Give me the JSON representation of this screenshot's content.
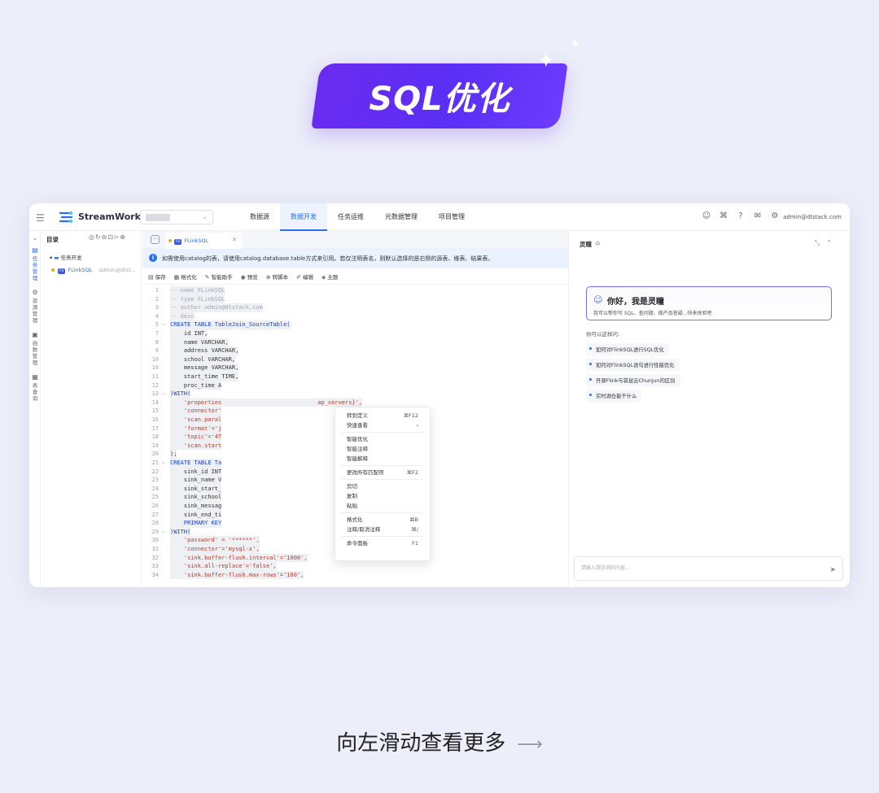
{
  "hero": {
    "title": "SQL优化"
  },
  "footer": {
    "hint": "向左滑动查看更多",
    "arrow": "⟶"
  },
  "app": {
    "logo": "StreamWorks",
    "nav": [
      "数据源",
      "数据开发",
      "任务运维",
      "元数据管理",
      "项目管理"
    ],
    "nav_active_index": 1,
    "user_email": "admin@dtstack.com",
    "rail": [
      {
        "label": "任\n务\n管\n理",
        "icon": "▤",
        "active": true
      },
      {
        "label": "资\n源\n管\n理",
        "icon": "⚙",
        "active": false
      },
      {
        "label": "函\n数\n管\n理",
        "icon": "▣",
        "active": false
      },
      {
        "label": "表\n查\n询",
        "icon": "▦",
        "active": false
      }
    ],
    "directory": {
      "title": "目录",
      "folder": "任务开发",
      "file_badge": "FS",
      "file": "FLinkSQL",
      "file_owner": "admin@dtst..."
    },
    "editor": {
      "tab_badge": "FS",
      "tab_label": "FLinkSQL",
      "notice": "如需使用catalog的表，请使用catalog.database.table方式来引用。若仅注明表名，则默认选择的是右侧的源表、维表、结果表。",
      "toolbar": [
        "保存",
        "格式化",
        "智能助手",
        "预览",
        "转脚本",
        "编辑",
        "主题"
      ],
      "lines": [
        {
          "n": "1",
          "t": "-- name FLinkSQL",
          "k": "com"
        },
        {
          "n": "2",
          "t": "-- type FLinkSQL",
          "k": "com"
        },
        {
          "n": "3",
          "t": "-- author admin@dtstack.com",
          "k": "com"
        },
        {
          "n": "4",
          "t": "-- desc",
          "k": "com"
        },
        {
          "n": "5",
          "t": "CREATE TABLE TableJoin_SourceTable(",
          "k": "kw",
          "fold": true
        },
        {
          "n": "7",
          "t": "    id INT,",
          "k": "def"
        },
        {
          "n": "8",
          "t": "    name VARCHAR,",
          "k": "def"
        },
        {
          "n": "9",
          "t": "    address VARCHAR,",
          "k": "def"
        },
        {
          "n": "10",
          "t": "    school VARCHAR,",
          "k": "def"
        },
        {
          "n": "10",
          "t": "    message VARCHAR,",
          "k": "def"
        },
        {
          "n": "11",
          "t": "    start_time TIME,",
          "k": "def"
        },
        {
          "n": "12",
          "t": "    proc_time A",
          "k": "def"
        },
        {
          "n": "13",
          "t": ")WITH(",
          "k": "kw",
          "fold": true
        },
        {
          "n": "14",
          "t": "    'properties                            ap_servers}',",
          "k": "str"
        },
        {
          "n": "15",
          "t": "    'connector'",
          "k": "str"
        },
        {
          "n": "16",
          "t": "    'scan.paral",
          "k": "str"
        },
        {
          "n": "17",
          "t": "    'format'='j",
          "k": "str"
        },
        {
          "n": "18",
          "t": "    'topic'='4T",
          "k": "str"
        },
        {
          "n": "19",
          "t": "    'scan.start",
          "k": "str"
        },
        {
          "n": "20",
          "t": ");",
          "k": "def"
        },
        {
          "n": "21",
          "t": "CREATE TABLE Ta",
          "k": "kw",
          "fold": true
        },
        {
          "n": "22",
          "t": "    sink_id INT",
          "k": "def"
        },
        {
          "n": "23",
          "t": "    sink_name V",
          "k": "def"
        },
        {
          "n": "24",
          "t": "    sink_start_",
          "k": "def"
        },
        {
          "n": "25",
          "t": "    sink_school",
          "k": "def"
        },
        {
          "n": "26",
          "t": "    sink_messag",
          "k": "def"
        },
        {
          "n": "27",
          "t": "    sink_end_ti",
          "k": "def"
        },
        {
          "n": "28",
          "t": "    PRIMARY KEY",
          "k": "kw"
        },
        {
          "n": "29",
          "t": ")WITH(",
          "k": "kw",
          "fold": true
        },
        {
          "n": "30",
          "t": "    'password' = '******',",
          "k": "str"
        },
        {
          "n": "31",
          "t": "    'connector'='mysql-x',",
          "k": "str"
        },
        {
          "n": "32",
          "t": "    'sink.buffer-flush.interval'='1000',",
          "k": "str"
        },
        {
          "n": "33",
          "t": "    'sink.all-replace'='false',",
          "k": "str"
        },
        {
          "n": "34",
          "t": "    'sink.buffer-flush.max-rows'='100',",
          "k": "str"
        }
      ],
      "context_menu": [
        {
          "label": "转到定义",
          "shortcut": "⌘F12"
        },
        {
          "label": "快速查看",
          "shortcut": "›"
        },
        {
          "sep": true
        },
        {
          "label": "智能优化",
          "shortcut": ""
        },
        {
          "label": "智能注释",
          "shortcut": ""
        },
        {
          "label": "智能解释",
          "shortcut": ""
        },
        {
          "sep": true
        },
        {
          "label": "更改所有匹配项",
          "shortcut": "⌘F2"
        },
        {
          "sep": true
        },
        {
          "label": "剪切",
          "shortcut": ""
        },
        {
          "label": "复制",
          "shortcut": ""
        },
        {
          "label": "粘贴",
          "shortcut": ""
        },
        {
          "sep": true
        },
        {
          "label": "格式化",
          "shortcut": "⌘B"
        },
        {
          "label": "注释/取消注释",
          "shortcut": "⌘/"
        },
        {
          "sep": true
        },
        {
          "label": "命令面板",
          "shortcut": "F1"
        }
      ]
    },
    "chat": {
      "title": "灵瞳",
      "greeting": "你好，我是灵瞳",
      "greeting_sub": "我可以帮你写 SQL、查问题、做产品答疑...快来体验吧",
      "ask_label": "你可以这样问:",
      "suggestions": [
        "如何对FlinkSQL进行SQL优化",
        "如何对FlinkSQL语句进行性能优化",
        "开源Flink与袋鼠云Chunjun的区别",
        "实时湖仓能干什么"
      ],
      "input_placeholder": "请输入想咨询的内容..."
    }
  }
}
